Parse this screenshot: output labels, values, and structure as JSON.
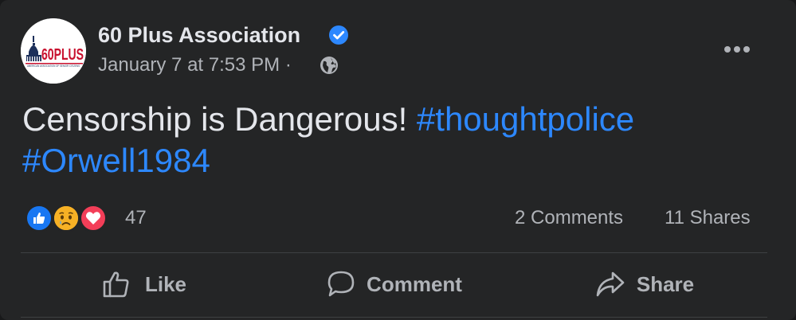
{
  "post": {
    "author_name": "60 Plus Association",
    "verified": true,
    "timestamp": "January 7 at 7:53 PM",
    "separator": "·",
    "audience_icon": "globe-icon",
    "logo": {
      "main_text": "60PLUS",
      "sub_text": "AMERICAN ASSOCIATION OF SENIOR CITIZENS",
      "brand_color": "#c8102e",
      "navy_color": "#1c2f5a"
    },
    "text": "Censorship is Dangerous!",
    "hashtags": [
      "#thoughtpolice",
      "#Orwell1984"
    ]
  },
  "engagement": {
    "reactions": [
      {
        "name": "like",
        "icon": "thumbs-up-icon",
        "color": "#1877f2"
      },
      {
        "name": "sad",
        "icon": "sad-face-icon",
        "color": "#f7b125"
      },
      {
        "name": "love",
        "icon": "heart-icon",
        "color": "#f33e58"
      }
    ],
    "reaction_count": "47",
    "comments": "2 Comments",
    "shares": "11 Shares"
  },
  "actions": {
    "like": {
      "label": "Like",
      "icon": "thumbs-up-outline-icon"
    },
    "comment": {
      "label": "Comment",
      "icon": "speech-bubble-icon"
    },
    "share": {
      "label": "Share",
      "icon": "share-arrow-icon"
    }
  },
  "colors": {
    "background": "#242526",
    "text_primary": "#e4e6eb",
    "text_secondary": "#b0b3b8",
    "link": "#2d88ff",
    "divider": "#3e4042"
  }
}
